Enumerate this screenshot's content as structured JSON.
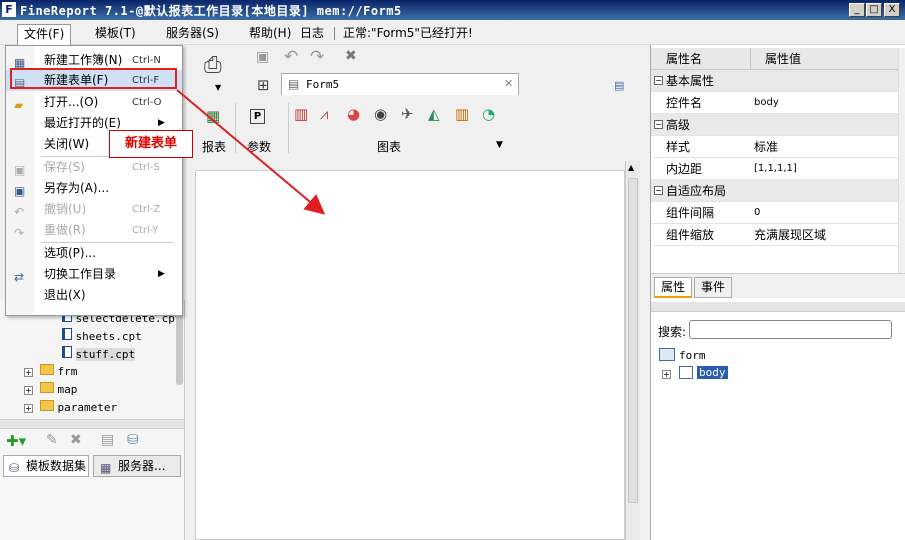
{
  "window": {
    "title": "FineReport 7.1-@默认报表工作目录[本地目录]    mem://Form5",
    "min": "_",
    "max": "□",
    "close": "X"
  },
  "menubar": {
    "file": "文件(F)",
    "template": "模板(T)",
    "server": "服务器(S)",
    "help": "帮助(H)",
    "log": "日志",
    "status": "正常:\"Form5\"已经打开!"
  },
  "file_menu": {
    "items": [
      {
        "label": "新建工作簿(N)",
        "shortcut": "Ctrl-N"
      },
      {
        "label": "新建表单(F)",
        "shortcut": "Ctrl-F"
      },
      {
        "label": "打开...(O)",
        "shortcut": "Ctrl-O"
      },
      {
        "label": "最近打开的(E)",
        "shortcut": ""
      },
      {
        "label": "关闭(W)",
        "shortcut": ""
      },
      {
        "label": "保存(S)",
        "shortcut": "Ctrl-S"
      },
      {
        "label": "另存为(A)...",
        "shortcut": ""
      },
      {
        "label": "撤销(U)",
        "shortcut": "Ctrl-Z"
      },
      {
        "label": "重做(R)",
        "shortcut": "Ctrl-Y"
      },
      {
        "label": "选项(P)...",
        "shortcut": ""
      },
      {
        "label": "切换工作目录",
        "shortcut": ""
      },
      {
        "label": "退出(X)",
        "shortcut": ""
      }
    ],
    "callout": "新建表单"
  },
  "file_tree": {
    "files": [
      "selectdelete.cpt",
      "sheets.cpt",
      "stuff.cpt"
    ],
    "folders": [
      "frm",
      "map",
      "parameter"
    ]
  },
  "dataset_tabs": [
    "模板数据集",
    "服务器..."
  ],
  "center": {
    "tab": "Form5",
    "groups": [
      "报表",
      "参数",
      "图表"
    ]
  },
  "properties": {
    "header_name": "属性名",
    "header_value": "属性值",
    "groups": [
      {
        "title": "基本属性",
        "rows": [
          {
            "k": "控件名",
            "v": "body"
          }
        ]
      },
      {
        "title": "高级",
        "rows": [
          {
            "k": "样式",
            "v": "标准"
          },
          {
            "k": "内边距",
            "v": "[1,1,1,1]"
          }
        ]
      },
      {
        "title": "自适应布局",
        "rows": [
          {
            "k": "组件间隔",
            "v": "0"
          },
          {
            "k": "组件缩放",
            "v": "充满展现区域"
          }
        ]
      }
    ],
    "tabs": [
      "属性",
      "事件"
    ]
  },
  "widget_tree": {
    "search_label": "搜索:",
    "root": "form",
    "child": "body"
  },
  "colors": {
    "accent_red": "#e02020",
    "title_blue": "#0a246a"
  }
}
